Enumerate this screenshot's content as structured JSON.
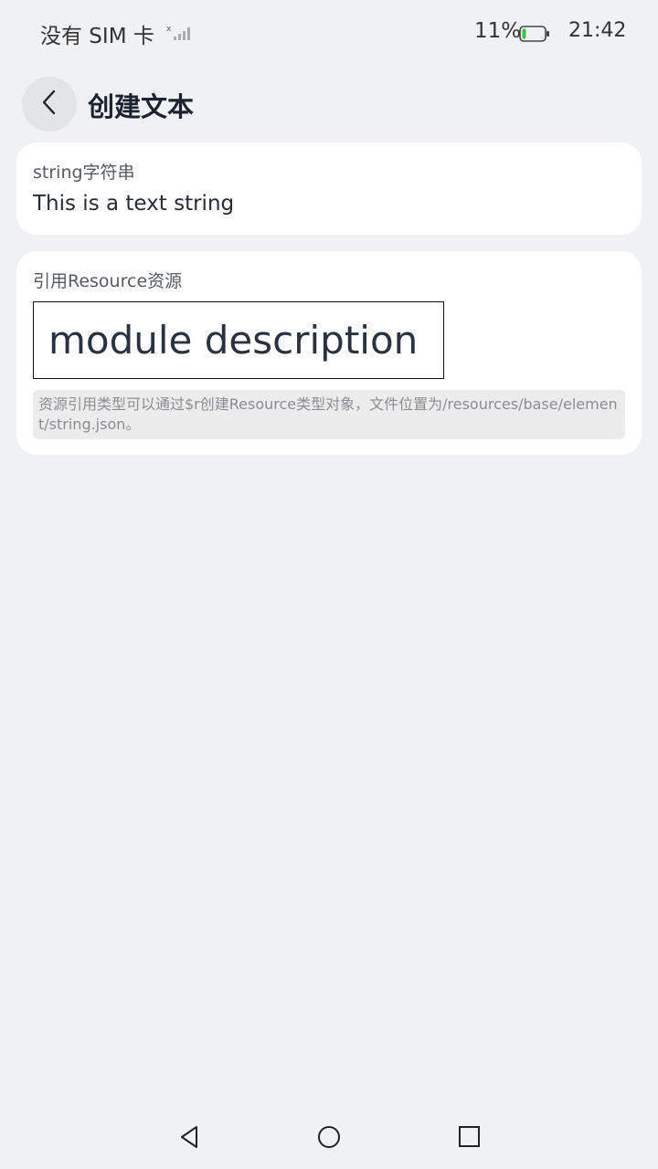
{
  "status_bar": {
    "carrier": "没有 SIM 卡",
    "battery": "11%",
    "time": "21:42",
    "signal_icon": "signal-icon",
    "battery_icon": "battery-icon"
  },
  "header": {
    "back_icon": "chevron-left-icon",
    "title": "创建文本"
  },
  "string_card": {
    "label": "string字符串",
    "value": "This is a text string"
  },
  "resource_card": {
    "label": "引用Resource资源",
    "value": "module description",
    "note": "资源引用类型可以通过$r创建Resource类型对象，文件位置为/resources/base/element/string.json。"
  },
  "nav_bar": {
    "back_icon": "triangle-back-icon",
    "home_icon": "circle-home-icon",
    "recent_icon": "square-recent-icon"
  },
  "colors": {
    "background": "#f0f1f3",
    "card": "#ffffff",
    "title": "#1b2330"
  }
}
